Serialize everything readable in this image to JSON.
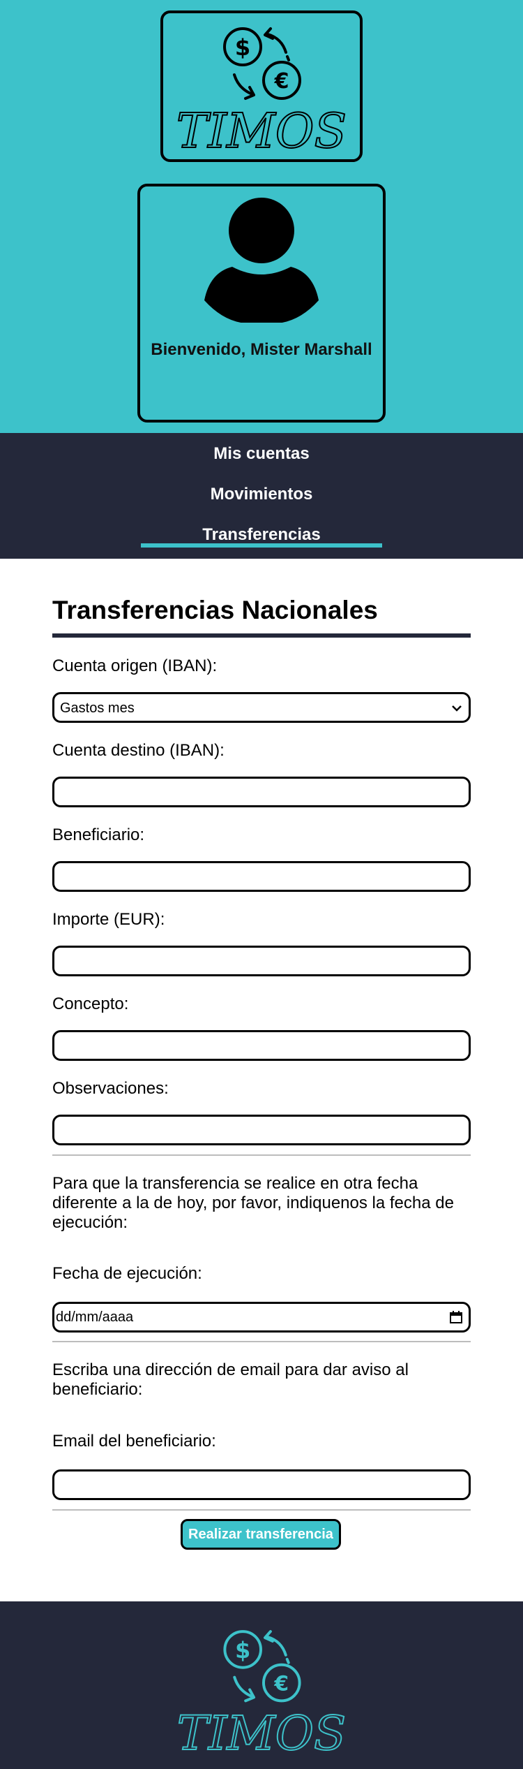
{
  "brand": {
    "name": "TIMOS",
    "accent_color": "#3dc2ca",
    "dark_color": "#24283a"
  },
  "header": {
    "welcome": "Bienvenido, Mister Marshall"
  },
  "nav": {
    "items": [
      {
        "label": "Mis cuentas"
      },
      {
        "label": "Movimientos"
      },
      {
        "label": "Transferencias",
        "active": true
      }
    ]
  },
  "form": {
    "title": "Transferencias Nacionales",
    "origin_label": "Cuenta origen (IBAN):",
    "origin_value": "Gastos mes",
    "dest_label": "Cuenta destino (IBAN):",
    "beneficiary_label": "Beneficiario:",
    "amount_label": "Importe (EUR):",
    "concept_label": "Concepto:",
    "notes_label": "Observaciones:",
    "date_note": "Para que la transferencia se realice en otra fecha diferente a la de hoy, por favor, indiquenos la fecha de ejecución:",
    "date_label": "Fecha de ejecución:",
    "date_placeholder": "dd/mm/aaaa",
    "email_note": "Escriba una dirección de email para dar aviso al beneficiario:",
    "email_label": "Email del beneficiario:",
    "submit_label": "Realizar transferencia"
  },
  "icons": {
    "logo": "currency-exchange-icon",
    "avatar": "user-avatar-icon",
    "select_arrow": "chevron-down-icon",
    "calendar": "calendar-icon"
  }
}
